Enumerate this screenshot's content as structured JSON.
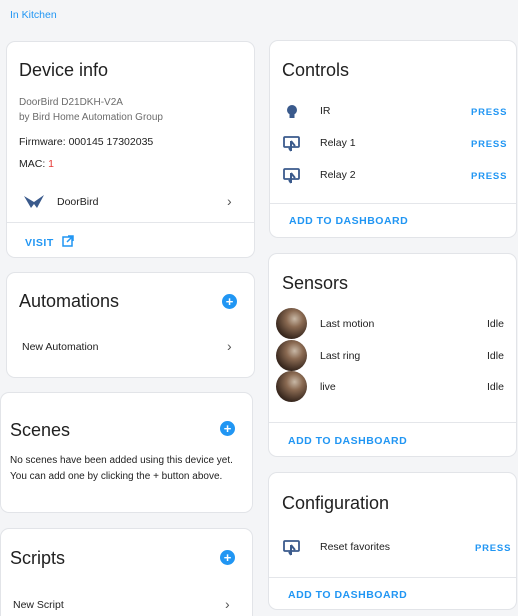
{
  "breadcrumb": "In Kitchen",
  "device_info": {
    "title": "Device info",
    "model": "DoorBird D21DKH-V2A",
    "manufacturer": "by Bird Home Automation Group",
    "firmware": "Firmware: 000145 17302035",
    "mac_label": "MAC: ",
    "mac_value": "1",
    "integration_name": "DoorBird",
    "visit_label": "VISIT"
  },
  "automations": {
    "title": "Automations",
    "items": [
      "New Automation"
    ]
  },
  "scenes": {
    "title": "Scenes",
    "empty_text": "No scenes have been added using this device yet. You can add one by clicking the + button above."
  },
  "scripts": {
    "title": "Scripts",
    "items": [
      "New Script"
    ]
  },
  "controls": {
    "title": "Controls",
    "items": [
      {
        "label": "IR",
        "action": "PRESS",
        "icon": "lightbulb-icon"
      },
      {
        "label": "Relay 1",
        "action": "PRESS",
        "icon": "gesture-tap-icon"
      },
      {
        "label": "Relay 2",
        "action": "PRESS",
        "icon": "gesture-tap-icon"
      }
    ],
    "add_label": "ADD TO DASHBOARD"
  },
  "sensors": {
    "title": "Sensors",
    "items": [
      {
        "label": "Last motion",
        "state": "Idle"
      },
      {
        "label": "Last ring",
        "state": "Idle"
      },
      {
        "label": "live",
        "state": "Idle"
      }
    ],
    "add_label": "ADD TO DASHBOARD"
  },
  "configuration": {
    "title": "Configuration",
    "items": [
      {
        "label": "Reset favorites",
        "action": "PRESS",
        "icon": "gesture-tap-icon"
      }
    ],
    "add_label": "ADD TO DASHBOARD"
  },
  "colors": {
    "accent": "#2196f3",
    "background": "#f4f5f7",
    "card": "#ffffff",
    "icon": "#3a5a8c"
  }
}
